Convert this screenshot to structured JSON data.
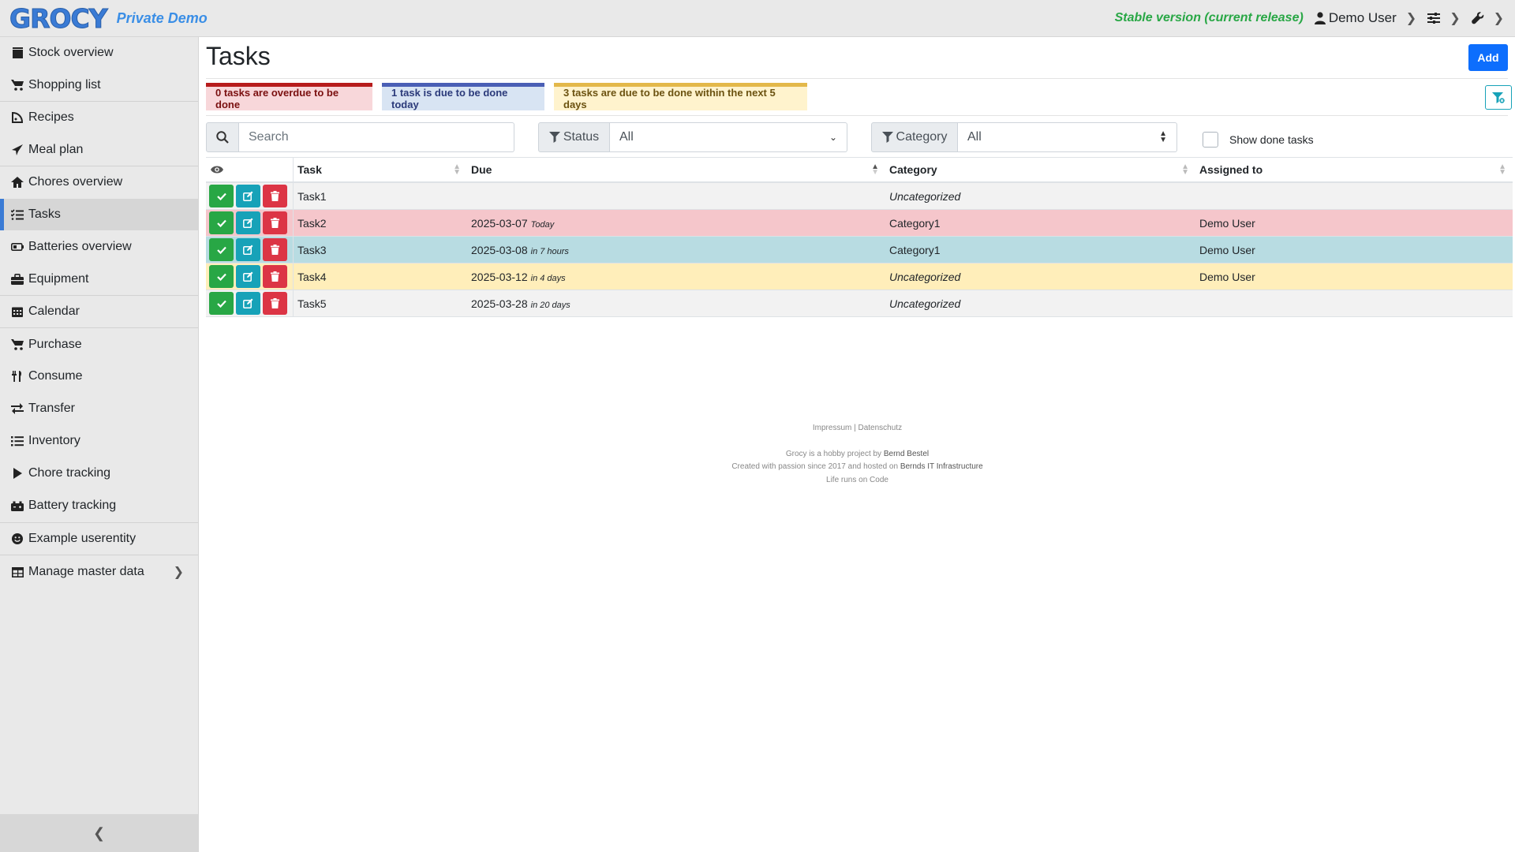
{
  "header": {
    "logo_text": "GROCY",
    "brand_sub": "Private Demo",
    "version": "Stable version (current release)",
    "user": "Demo User"
  },
  "sidebar": {
    "items": [
      {
        "label": "Stock overview",
        "icon": "box-icon"
      },
      {
        "label": "Shopping list",
        "icon": "cart-icon"
      },
      {
        "label": "Recipes",
        "icon": "pizza-icon"
      },
      {
        "label": "Meal plan",
        "icon": "paper-plane-icon"
      },
      {
        "label": "Chores overview",
        "icon": "home-icon"
      },
      {
        "label": "Tasks",
        "icon": "tasks-icon"
      },
      {
        "label": "Batteries overview",
        "icon": "battery-icon"
      },
      {
        "label": "Equipment",
        "icon": "toolbox-icon"
      },
      {
        "label": "Calendar",
        "icon": "calendar-icon"
      },
      {
        "label": "Purchase",
        "icon": "cart-plus-icon"
      },
      {
        "label": "Consume",
        "icon": "utensils-icon"
      },
      {
        "label": "Transfer",
        "icon": "exchange-icon"
      },
      {
        "label": "Inventory",
        "icon": "list-icon"
      },
      {
        "label": "Chore tracking",
        "icon": "play-icon"
      },
      {
        "label": "Battery tracking",
        "icon": "car-battery-icon"
      },
      {
        "label": "Example userentity",
        "icon": "smile-icon"
      },
      {
        "label": "Manage master data",
        "icon": "table-icon"
      }
    ],
    "active": "Tasks"
  },
  "main": {
    "title": "Tasks",
    "add_label": "Add",
    "badges": {
      "overdue": "0 tasks are overdue to be done",
      "today": "1 task is due to be done today",
      "soon": "3 tasks are due to be done within the next 5 days"
    },
    "filters": {
      "search_placeholder": "Search",
      "status_label": "Status",
      "status_value": "All",
      "category_label": "Category",
      "category_value": "All",
      "show_done_label": "Show done tasks"
    },
    "table": {
      "headers": [
        "Task",
        "Due",
        "Category",
        "Assigned to"
      ],
      "rows": [
        {
          "task": "Task1",
          "due": "",
          "due_rel": "",
          "category": "Uncategorized",
          "assigned": "",
          "status": "default"
        },
        {
          "task": "Task2",
          "due": "2025-03-07",
          "due_rel": "Today",
          "category": "Category1",
          "assigned": "Demo User",
          "status": "red"
        },
        {
          "task": "Task3",
          "due": "2025-03-08",
          "due_rel": "in 7 hours",
          "category": "Category1",
          "assigned": "Demo User",
          "status": "blue"
        },
        {
          "task": "Task4",
          "due": "2025-03-12",
          "due_rel": "in 4 days",
          "category": "Uncategorized",
          "assigned": "Demo User",
          "status": "yellow"
        },
        {
          "task": "Task5",
          "due": "2025-03-28",
          "due_rel": "in 20 days",
          "category": "Uncategorized",
          "assigned": "",
          "status": "default"
        }
      ]
    }
  },
  "footer": {
    "links": "Impressum | Datenschutz",
    "line1_pre": "Grocy is a hobby project by ",
    "line1_link": "Bernd Bestel",
    "line2_pre": "Created with passion since 2017 and hosted on ",
    "line2_link": "Bernds IT Infrastructure",
    "line3": "Life runs on Code"
  },
  "colors": {
    "primary": "#0d6efd",
    "success": "#28a745",
    "info": "#17a2b8",
    "danger": "#dc3545",
    "row_red": "#f5c6cb",
    "row_blue": "#b8dce2",
    "row_yellow": "#ffeeba"
  }
}
